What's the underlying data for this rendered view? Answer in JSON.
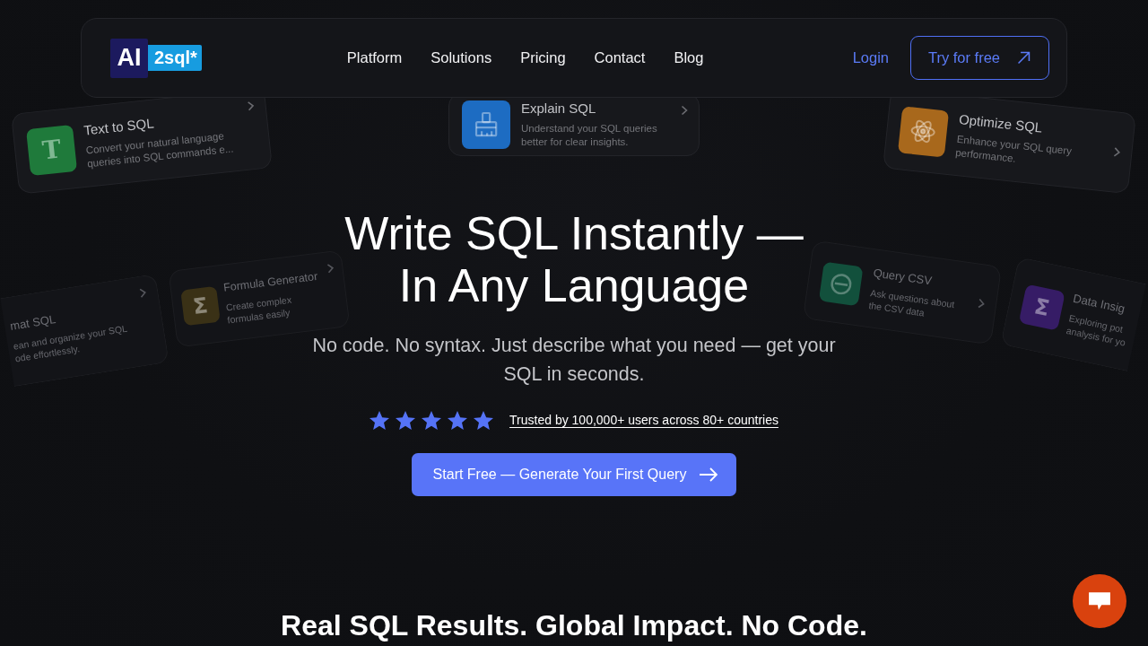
{
  "nav": {
    "logo": {
      "mark": "AI",
      "wordmark": "2sql*"
    },
    "links": [
      "Platform",
      "Solutions",
      "Pricing",
      "Contact",
      "Blog"
    ],
    "login": "Login",
    "cta": "Try for free"
  },
  "background_cards": [
    {
      "title": "Text to SQL",
      "description": "Convert your natural language queries into SQL commands e...",
      "glyph": "T",
      "color": "#1f7a3b"
    },
    {
      "title": "Explain SQL",
      "description": "Understand your SQL queries better for clear insights.",
      "color": "#1d6cc2"
    },
    {
      "title": "Optimize SQL",
      "description": "Enhance your SQL query performance.",
      "color": "#a8681c"
    },
    {
      "title": "mat SQL",
      "description": "ean and organize your SQL ode effortlessly."
    },
    {
      "title": "Formula Generator",
      "description": "Create complex formulas easily",
      "glyph": "Σ",
      "color": "#3a3116"
    },
    {
      "title": "Query CSV",
      "description": "Ask questions about the CSV data",
      "color": "#12503c"
    },
    {
      "title": "Data Insig",
      "description": "Exploring pot analysis for yo",
      "glyph": "Σ",
      "color": "#361c66"
    }
  ],
  "hero": {
    "title": "Write SQL Instantly — In Any Language",
    "subtitle": "No code. No syntax. Just describe what you need — get your SQL in seconds.",
    "rating": {
      "stars": 5,
      "text": "Trusted by 100,000+ users across 80+ countries"
    },
    "cta": "Start Free — Generate Your First Query"
  },
  "next_section": {
    "title": "Real SQL Results. Global Impact. No Code."
  }
}
